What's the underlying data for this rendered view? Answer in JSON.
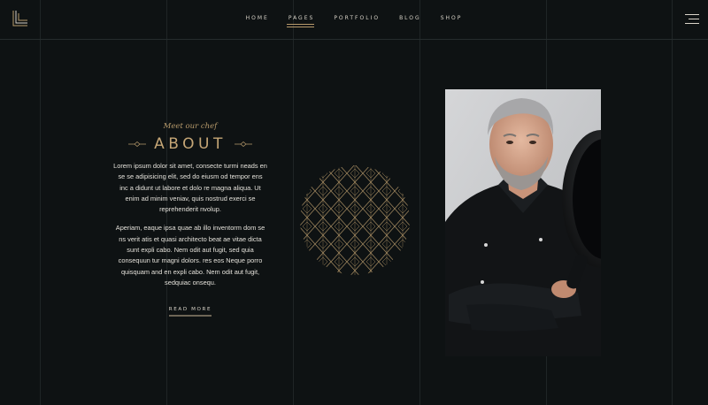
{
  "nav": {
    "items": [
      {
        "label": "HOME",
        "active": false
      },
      {
        "label": "PAGES",
        "active": true
      },
      {
        "label": "PORTFOLIO",
        "active": false
      },
      {
        "label": "BLOG",
        "active": false
      },
      {
        "label": "SHOP",
        "active": false
      }
    ]
  },
  "about": {
    "eyebrow": "Meet our chef",
    "title": "ABOUT",
    "paragraph1": "Lorem ipsum dolor sit amet, consecte turmi neads en se se adipisicing elit, sed do eiusm od tempor ens inc a didunt ut labore et dolo re magna aliqua. Ut enim ad minim veniav, quis nostrud exerci se reprehenderit nvolup.",
    "paragraph2": "Aperiam, eaque ipsa quae ab illo inventorm dom se ns verit atis et quasi architecto beat ae vitae dicta sunt expli cabo. Nem odit aut fugit, sed quia consequun tur magni dolors. res eos Neque porro quisquam and en expli cabo. Nem odit aut fugit, sedquiac onsequ.",
    "read_more": "READ MORE"
  },
  "icons": {
    "logo": "logo-icon",
    "menu": "hamburger-menu-icon",
    "ornament": "ornament-icon",
    "pattern": "art-deco-pattern"
  },
  "colors": {
    "background": "#0e1213",
    "accent_gold": "#c5a676",
    "text": "#e4e1da"
  }
}
